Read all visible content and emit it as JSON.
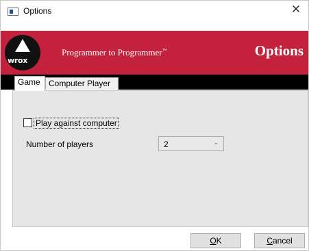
{
  "window": {
    "title": "Options",
    "close_glyph": "✕"
  },
  "banner": {
    "logo_text": "wrox",
    "tagline": "Programmer to Programmer",
    "trademark": "™",
    "title": "Options",
    "color": "#c4213c"
  },
  "tabs": [
    {
      "label": "Game",
      "selected": true
    },
    {
      "label": "Computer Player",
      "selected": false
    }
  ],
  "game": {
    "play_against_computer": {
      "label": "Play against computer",
      "checked": false
    },
    "number_of_players": {
      "label": "Number of players",
      "value": "2",
      "chevron": "⌄"
    }
  },
  "buttons": {
    "ok": {
      "mnemonic": "O",
      "rest": "K"
    },
    "cancel": {
      "mnemonic": "C",
      "rest": "ancel"
    }
  }
}
